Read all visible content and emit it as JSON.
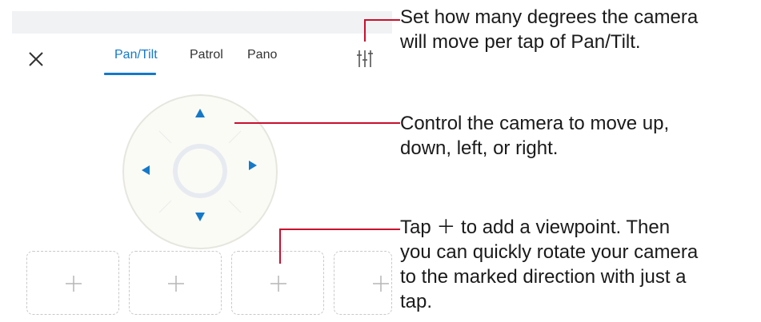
{
  "tabs": [
    {
      "label": "Pan/Tilt",
      "active": true
    },
    {
      "label": "Patrol",
      "active": false
    },
    {
      "label": "Pano",
      "active": false
    }
  ],
  "icons": {
    "close": "close-icon",
    "settings": "sliders-icon",
    "up": "arrow-up-icon",
    "down": "arrow-down-icon",
    "left": "arrow-left-icon",
    "right": "arrow-right-icon",
    "add": "plus-icon"
  },
  "colors": {
    "accent": "#1479c9",
    "callout_line": "#c8102e"
  },
  "viewpoint_slots": [
    {
      "symbol": ""
    },
    {
      "symbol": ""
    },
    {
      "symbol": ""
    },
    {
      "symbol": ""
    }
  ],
  "callouts": {
    "settings": {
      "line1": "Set how many degrees the camera",
      "line2": "will move per tap of Pan/Tilt."
    },
    "pad": {
      "line1": "Control the camera to move up,",
      "line2": "down, left, or right."
    },
    "add": {
      "line1": "Tap ＋ to add a viewpoint. Then",
      "line2": "you can quickly rotate your camera",
      "line3": "to the marked direction with just a",
      "line4": "tap."
    }
  }
}
